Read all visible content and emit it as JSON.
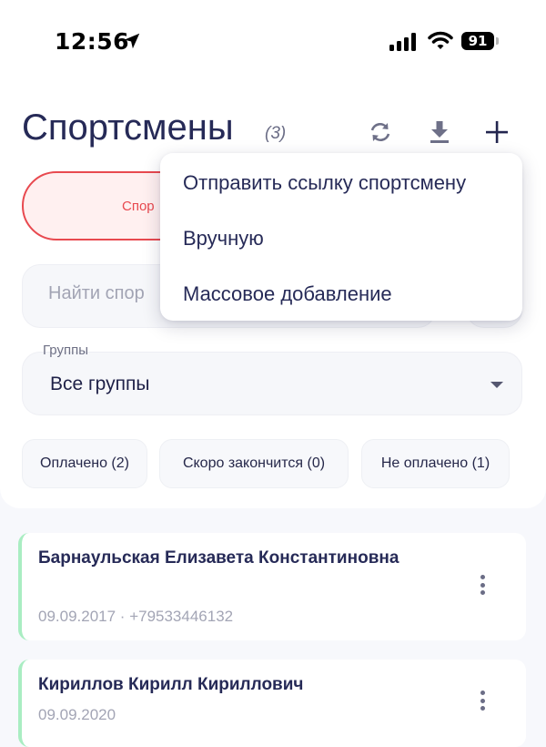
{
  "status_bar": {
    "time": "12:56",
    "battery": "91",
    "icons": [
      "location-arrow-icon",
      "signal-icon",
      "wifi-icon",
      "battery-icon"
    ]
  },
  "header": {
    "title": "Спортсмены",
    "count": "(3)",
    "actions": [
      "refresh-icon",
      "download-icon",
      "plus-icon"
    ]
  },
  "segment": {
    "active_label_visible": "Спор"
  },
  "search": {
    "placeholder": "Найти спор"
  },
  "groups": {
    "label": "Группы",
    "selected": "Все группы"
  },
  "filters": {
    "chips": [
      {
        "label": "Оплачено (2)"
      },
      {
        "label": "Скоро закончится (0)"
      },
      {
        "label": "Не оплачено (1)"
      }
    ]
  },
  "athletes": [
    {
      "name": "Барнаульская Елизавета Константиновна",
      "meta": "09.09.2017 · +79533446132"
    },
    {
      "name": "Кириллов Кирилл Кириллович",
      "meta": "09.09.2020"
    }
  ],
  "menu": {
    "items": [
      {
        "label": "Отправить ссылку спортсмену"
      },
      {
        "label": "Вручную"
      },
      {
        "label": "Массовое добавление"
      }
    ]
  },
  "colors": {
    "accent_red": "#e8494f",
    "status_green": "#a9edc2",
    "title_navy": "#262a57"
  }
}
